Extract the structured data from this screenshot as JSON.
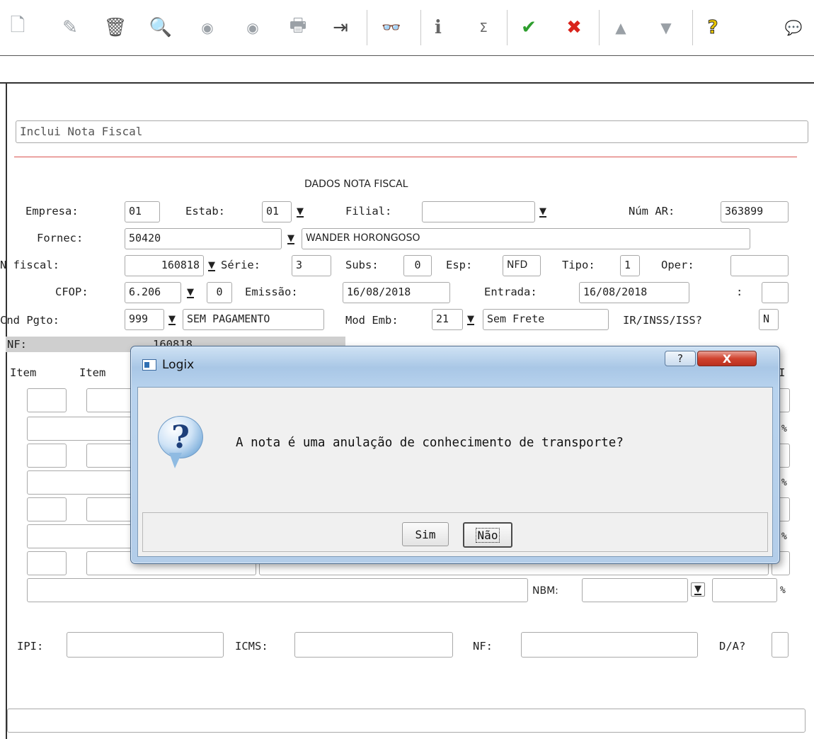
{
  "toolbar": {
    "icons": [
      "new-doc-icon",
      "edit-icon",
      "delete-icon",
      "search-icon",
      "prev-icon",
      "next-icon",
      "print-icon",
      "exit-icon",
      "find-icon",
      "info-icon",
      "sigma-icon",
      "confirm-icon",
      "cancel-icon",
      "up-icon",
      "down-icon",
      "help-icon",
      "chat-icon"
    ],
    "glyphs": {
      "new": "🗋",
      "edit": "✎",
      "delete": "🗑",
      "search": "🔍",
      "prev": "◉",
      "next": "◉",
      "print": "🖶",
      "exit": "⇥",
      "find": "👓",
      "info": "i",
      "sigma": "Σ",
      "confirm": "✔",
      "cancel": "✖",
      "up": "▲",
      "down": "▼",
      "help": "?",
      "chat": "💬"
    },
    "colors": {
      "confirm": "#2e9e2e",
      "cancel": "#d9241c",
      "help": "#e8c400"
    }
  },
  "header": {
    "action_text": "Inclui Nota Fiscal"
  },
  "form": {
    "section_title": "DADOS NOTA FISCAL",
    "empresa_label": "Empresa:",
    "empresa": "01",
    "estab_label": "Estab:",
    "estab": "01",
    "filial_label": "Filial:",
    "filial": "",
    "num_ar_label": "Núm AR:",
    "num_ar": "363899",
    "fornec_label": "Fornec:",
    "fornec": "50420",
    "fornec_nome": "WANDER HORONGOSO",
    "n_fiscal_label": "N fiscal:",
    "n_fiscal": "160818",
    "serie_label": "Série:",
    "serie": "3",
    "subs_label": "Subs:",
    "subs": "0",
    "esp_label": "Esp:",
    "esp": "NFD",
    "tipo_label": "Tipo:",
    "tipo": "1",
    "oper_label": "Oper:",
    "oper": "",
    "cfop_label": "CFOP:",
    "cfop": "6.206",
    "cfop_seq": "0",
    "emissao_label": "Emissão:",
    "emissao": "16/08/2018",
    "entrada_label": "Entrada:",
    "entrada": "16/08/2018",
    "extra_label": ":",
    "cnd_pgto_label": "Cnd Pgto:",
    "cnd_pgto": "999",
    "cnd_pgto_desc": "SEM PAGAMENTO",
    "mod_emb_label": "Mod Emb:",
    "mod_emb": "21",
    "mod_emb_desc": "Sem Frete",
    "ir_label": "IR/INSS/ISS?",
    "ir": "N",
    "nf_label": "NF:",
    "nf_value": "160818",
    "item_label": "Item",
    "item2_label": "Item",
    "col_i_label": "I",
    "pct": "%",
    "nbm_label": "NBM:",
    "ipi_label": "IPI:",
    "icms_label": "ICMS:",
    "nf2_label": "NF:",
    "da_label": "D/A?"
  },
  "dialog": {
    "title": "Logix",
    "help_glyph": "?",
    "close_glyph": "X",
    "message": "A nota é uma anulação de conhecimento de transporte?",
    "q_glyph": "?",
    "btn_sim": "Sim",
    "btn_nao": "Não"
  }
}
